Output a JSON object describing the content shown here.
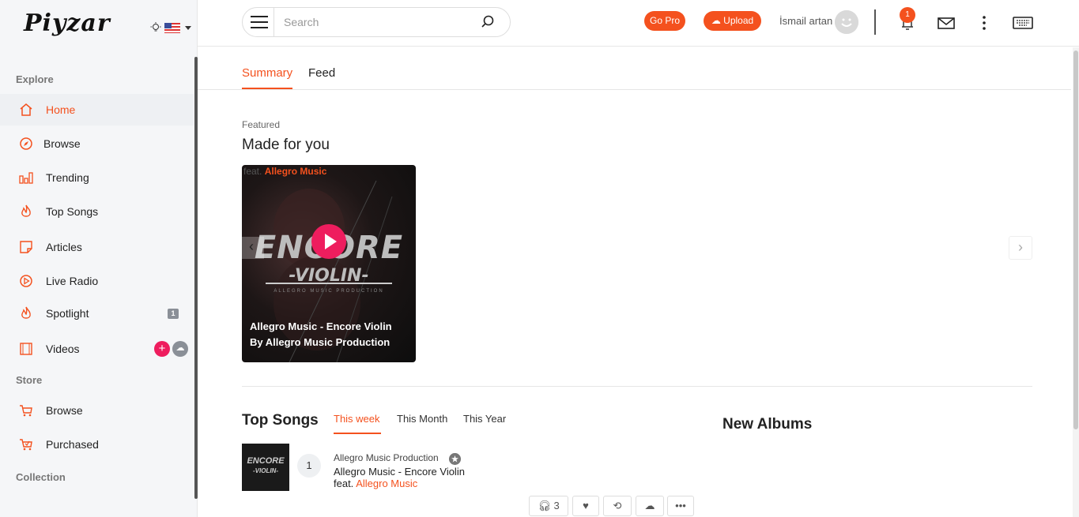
{
  "app": {
    "logo_text": "Piyzar",
    "accent_color": "#f4511e"
  },
  "sidebar": {
    "sections": {
      "explore": "Explore",
      "store": "Store",
      "collection": "Collection"
    },
    "items": [
      {
        "label": "Home",
        "icon": "home-icon"
      },
      {
        "label": "Browse",
        "icon": "compass-icon"
      },
      {
        "label": "Trending",
        "icon": "bar-chart-icon"
      },
      {
        "label": "Top Songs",
        "icon": "flame-icon"
      },
      {
        "label": "Articles",
        "icon": "article-icon"
      },
      {
        "label": "Live Radio",
        "icon": "play-circle-icon"
      },
      {
        "label": "Spotlight",
        "icon": "flame-icon",
        "badge": "1"
      },
      {
        "label": "Videos",
        "icon": "film-icon"
      }
    ],
    "store_items": [
      {
        "label": "Browse",
        "icon": "cart-icon"
      },
      {
        "label": "Purchased",
        "icon": "cart-check-icon"
      }
    ]
  },
  "header": {
    "search_placeholder": "Search",
    "go_pro": "Go Pro",
    "upload": "Upload",
    "username": "İsmail artan",
    "notification_count": "1"
  },
  "tabs": [
    "Summary",
    "Feed"
  ],
  "featured": {
    "label": "Featured",
    "title": "Made for you",
    "card": {
      "feat_prefix": "feat.",
      "feat_artist": "Allegro Music",
      "art_title": "ENCORE",
      "art_subtitle": "-VIOLIN-",
      "art_production": "ALLEGRO MUSIC PRODUCTION",
      "line1": "Allegro Music - Encore Violin",
      "line2": "By Allegro Music Production"
    }
  },
  "top_songs": {
    "title": "Top Songs",
    "tabs": [
      "This week",
      "This Month",
      "This Year"
    ],
    "songs": [
      {
        "rank": "1",
        "thumb_title": "ENCORE",
        "thumb_subtitle": "-VIOLIN-",
        "artist": "Allegro Music Production",
        "title": "Allegro Music - Encore Violin",
        "feat_prefix": "feat.",
        "feat_artist": "Allegro Music",
        "plays": "3"
      }
    ]
  },
  "new_albums": {
    "title": "New Albums"
  }
}
